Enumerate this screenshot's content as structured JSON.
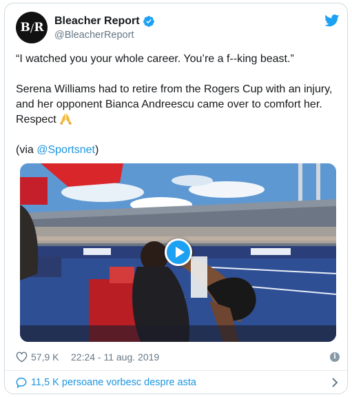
{
  "account": {
    "avatar_text_left": "B",
    "avatar_text_sep": "/",
    "avatar_text_right": "R",
    "display_name": "Bleacher Report",
    "handle": "@BleacherReport",
    "verified_icon": "verified-badge-icon",
    "brand_icon": "twitter-bird-icon"
  },
  "tweet": {
    "quote": "“I watched you your whole career. You’re a f--king beast.”",
    "body": "Serena Williams had to retire from the Rogers Cup with an injury, and her opponent Bianca Andreescu came over to comfort her. Respect",
    "emoji": "folded-hands-icon",
    "via_prefix": "(via ",
    "via_mention": "@Sportsnet",
    "via_suffix": ")"
  },
  "media": {
    "type": "video",
    "play_icon": "play-icon"
  },
  "meta": {
    "likes": "57,9 K",
    "timestamp": "22:24 - 11 aug. 2019",
    "info_icon": "info-icon"
  },
  "footer": {
    "conversation": "11,5 K persoane vorbesc despre asta",
    "chevron_icon": "chevron-right-icon"
  },
  "colors": {
    "accent": "#1da1f2",
    "link": "#1b95e0",
    "muted": "#657786",
    "border": "#cfd9de"
  }
}
